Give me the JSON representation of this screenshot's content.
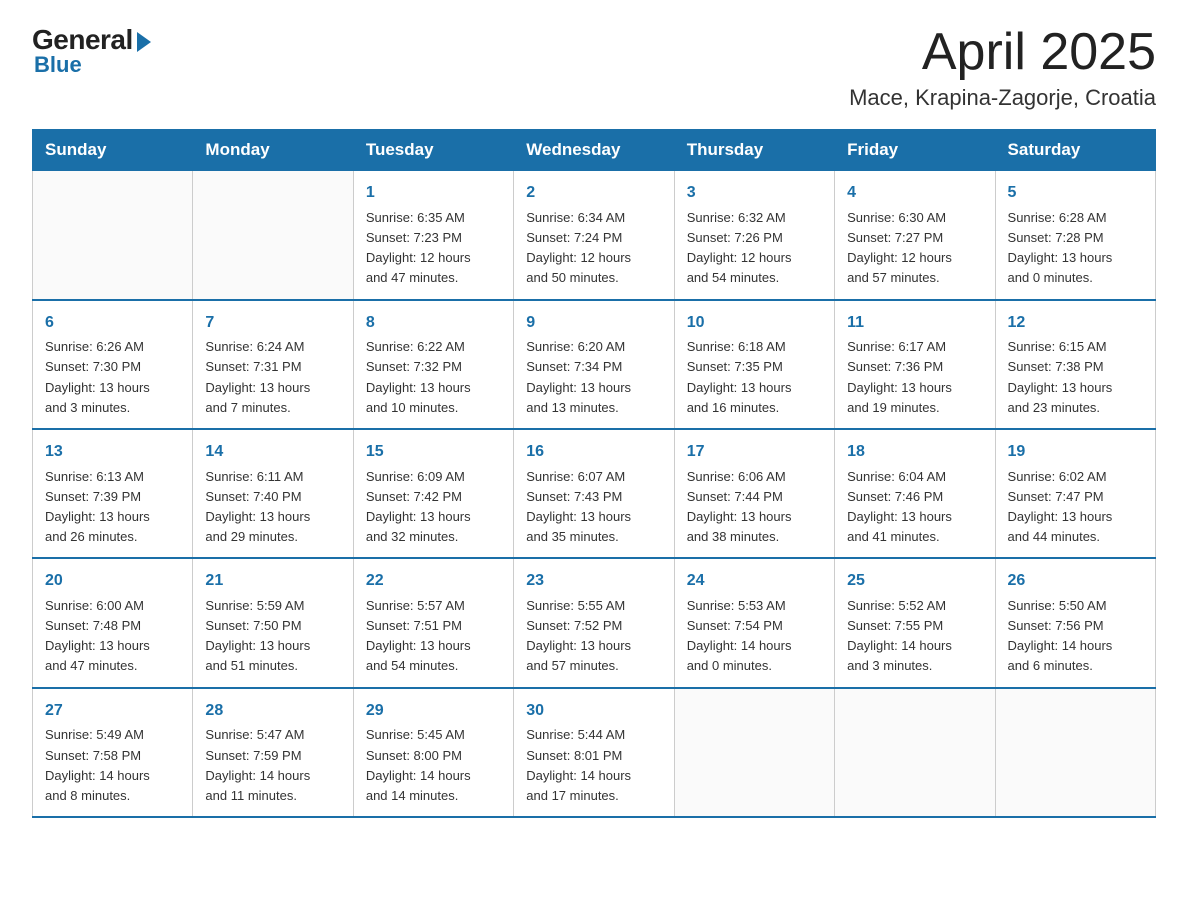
{
  "logo": {
    "general": "General",
    "blue": "Blue"
  },
  "title": "April 2025",
  "location": "Mace, Krapina-Zagorje, Croatia",
  "days_header": [
    "Sunday",
    "Monday",
    "Tuesday",
    "Wednesday",
    "Thursday",
    "Friday",
    "Saturday"
  ],
  "weeks": [
    [
      {
        "day": "",
        "info": ""
      },
      {
        "day": "",
        "info": ""
      },
      {
        "day": "1",
        "info": "Sunrise: 6:35 AM\nSunset: 7:23 PM\nDaylight: 12 hours\nand 47 minutes."
      },
      {
        "day": "2",
        "info": "Sunrise: 6:34 AM\nSunset: 7:24 PM\nDaylight: 12 hours\nand 50 minutes."
      },
      {
        "day": "3",
        "info": "Sunrise: 6:32 AM\nSunset: 7:26 PM\nDaylight: 12 hours\nand 54 minutes."
      },
      {
        "day": "4",
        "info": "Sunrise: 6:30 AM\nSunset: 7:27 PM\nDaylight: 12 hours\nand 57 minutes."
      },
      {
        "day": "5",
        "info": "Sunrise: 6:28 AM\nSunset: 7:28 PM\nDaylight: 13 hours\nand 0 minutes."
      }
    ],
    [
      {
        "day": "6",
        "info": "Sunrise: 6:26 AM\nSunset: 7:30 PM\nDaylight: 13 hours\nand 3 minutes."
      },
      {
        "day": "7",
        "info": "Sunrise: 6:24 AM\nSunset: 7:31 PM\nDaylight: 13 hours\nand 7 minutes."
      },
      {
        "day": "8",
        "info": "Sunrise: 6:22 AM\nSunset: 7:32 PM\nDaylight: 13 hours\nand 10 minutes."
      },
      {
        "day": "9",
        "info": "Sunrise: 6:20 AM\nSunset: 7:34 PM\nDaylight: 13 hours\nand 13 minutes."
      },
      {
        "day": "10",
        "info": "Sunrise: 6:18 AM\nSunset: 7:35 PM\nDaylight: 13 hours\nand 16 minutes."
      },
      {
        "day": "11",
        "info": "Sunrise: 6:17 AM\nSunset: 7:36 PM\nDaylight: 13 hours\nand 19 minutes."
      },
      {
        "day": "12",
        "info": "Sunrise: 6:15 AM\nSunset: 7:38 PM\nDaylight: 13 hours\nand 23 minutes."
      }
    ],
    [
      {
        "day": "13",
        "info": "Sunrise: 6:13 AM\nSunset: 7:39 PM\nDaylight: 13 hours\nand 26 minutes."
      },
      {
        "day": "14",
        "info": "Sunrise: 6:11 AM\nSunset: 7:40 PM\nDaylight: 13 hours\nand 29 minutes."
      },
      {
        "day": "15",
        "info": "Sunrise: 6:09 AM\nSunset: 7:42 PM\nDaylight: 13 hours\nand 32 minutes."
      },
      {
        "day": "16",
        "info": "Sunrise: 6:07 AM\nSunset: 7:43 PM\nDaylight: 13 hours\nand 35 minutes."
      },
      {
        "day": "17",
        "info": "Sunrise: 6:06 AM\nSunset: 7:44 PM\nDaylight: 13 hours\nand 38 minutes."
      },
      {
        "day": "18",
        "info": "Sunrise: 6:04 AM\nSunset: 7:46 PM\nDaylight: 13 hours\nand 41 minutes."
      },
      {
        "day": "19",
        "info": "Sunrise: 6:02 AM\nSunset: 7:47 PM\nDaylight: 13 hours\nand 44 minutes."
      }
    ],
    [
      {
        "day": "20",
        "info": "Sunrise: 6:00 AM\nSunset: 7:48 PM\nDaylight: 13 hours\nand 47 minutes."
      },
      {
        "day": "21",
        "info": "Sunrise: 5:59 AM\nSunset: 7:50 PM\nDaylight: 13 hours\nand 51 minutes."
      },
      {
        "day": "22",
        "info": "Sunrise: 5:57 AM\nSunset: 7:51 PM\nDaylight: 13 hours\nand 54 minutes."
      },
      {
        "day": "23",
        "info": "Sunrise: 5:55 AM\nSunset: 7:52 PM\nDaylight: 13 hours\nand 57 minutes."
      },
      {
        "day": "24",
        "info": "Sunrise: 5:53 AM\nSunset: 7:54 PM\nDaylight: 14 hours\nand 0 minutes."
      },
      {
        "day": "25",
        "info": "Sunrise: 5:52 AM\nSunset: 7:55 PM\nDaylight: 14 hours\nand 3 minutes."
      },
      {
        "day": "26",
        "info": "Sunrise: 5:50 AM\nSunset: 7:56 PM\nDaylight: 14 hours\nand 6 minutes."
      }
    ],
    [
      {
        "day": "27",
        "info": "Sunrise: 5:49 AM\nSunset: 7:58 PM\nDaylight: 14 hours\nand 8 minutes."
      },
      {
        "day": "28",
        "info": "Sunrise: 5:47 AM\nSunset: 7:59 PM\nDaylight: 14 hours\nand 11 minutes."
      },
      {
        "day": "29",
        "info": "Sunrise: 5:45 AM\nSunset: 8:00 PM\nDaylight: 14 hours\nand 14 minutes."
      },
      {
        "day": "30",
        "info": "Sunrise: 5:44 AM\nSunset: 8:01 PM\nDaylight: 14 hours\nand 17 minutes."
      },
      {
        "day": "",
        "info": ""
      },
      {
        "day": "",
        "info": ""
      },
      {
        "day": "",
        "info": ""
      }
    ]
  ]
}
